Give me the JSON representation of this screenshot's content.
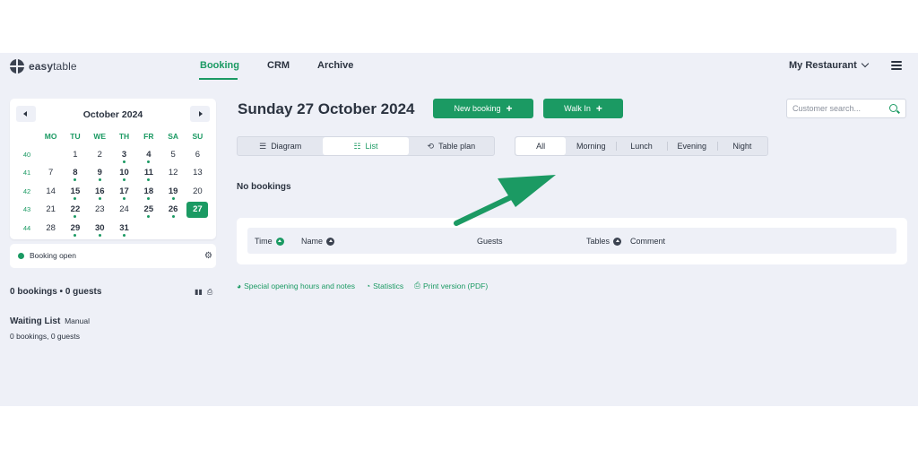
{
  "logo": {
    "text_bold": "easy",
    "text_rest": "table"
  },
  "nav": {
    "items": [
      {
        "label": "Booking"
      },
      {
        "label": "CRM"
      },
      {
        "label": "Archive"
      }
    ]
  },
  "restaurant": {
    "label": "My Restaurant"
  },
  "calendar": {
    "month": "October 2024",
    "weekday_headers": [
      "MO",
      "TU",
      "WE",
      "TH",
      "FR",
      "SA",
      "SU"
    ],
    "weeks": [
      {
        "week": "40",
        "days": [
          "",
          "1",
          "2",
          "3",
          "4",
          "5",
          "6"
        ]
      },
      {
        "week": "41",
        "days": [
          "7",
          "8",
          "9",
          "10",
          "11",
          "12",
          "13"
        ]
      },
      {
        "week": "42",
        "days": [
          "14",
          "15",
          "16",
          "17",
          "18",
          "19",
          "20"
        ]
      },
      {
        "week": "43",
        "days": [
          "21",
          "22",
          "23",
          "24",
          "25",
          "26",
          "27"
        ]
      },
      {
        "week": "44",
        "days": [
          "28",
          "29",
          "30",
          "31",
          "",
          "",
          ""
        ]
      }
    ],
    "selected_day": "27",
    "days_with_bookings": [
      "3",
      "4",
      "8",
      "9",
      "10",
      "11",
      "15",
      "16",
      "17",
      "18",
      "19",
      "22",
      "25",
      "26",
      "29",
      "30",
      "31"
    ]
  },
  "status": {
    "label": "Booking open"
  },
  "summary": {
    "text": "0 bookings • 0 guests"
  },
  "waiting_list": {
    "title": "Waiting List",
    "mode": "Manual",
    "sub": "0 bookings, 0 guests"
  },
  "main": {
    "date_title": "Sunday 27 October 2024",
    "new_booking_label": "New booking",
    "walk_in_label": "Walk In",
    "search_placeholder": "Customer search...",
    "views": [
      {
        "label": "Diagram"
      },
      {
        "label": "List"
      },
      {
        "label": "Table plan"
      }
    ],
    "active_view": "List",
    "time_filters": [
      {
        "label": "All"
      },
      {
        "label": "Morning"
      },
      {
        "label": "Lunch"
      },
      {
        "label": "Evening"
      },
      {
        "label": "Night"
      }
    ],
    "active_time_filter": "All",
    "no_bookings": "No bookings",
    "columns": [
      {
        "label": "Time"
      },
      {
        "label": "Name"
      },
      {
        "label": "Guests"
      },
      {
        "label": "Tables"
      },
      {
        "label": "Comment"
      }
    ],
    "links": [
      {
        "label": "Special opening hours and notes"
      },
      {
        "label": "Statistics"
      },
      {
        "label": "Print version (PDF)"
      }
    ]
  },
  "colors": {
    "accent": "#1b9a63",
    "background": "#eef0f7",
    "text": "#2b3340",
    "card": "#ffffff"
  },
  "icons": [
    "menu-icon",
    "gear-icon",
    "bar-chart-icon",
    "printer-icon",
    "search-icon",
    "diagram-icon",
    "list-icon",
    "table-plan-icon",
    "plus-icon",
    "sort-icon",
    "info-icon",
    "pie-chart-icon"
  ]
}
